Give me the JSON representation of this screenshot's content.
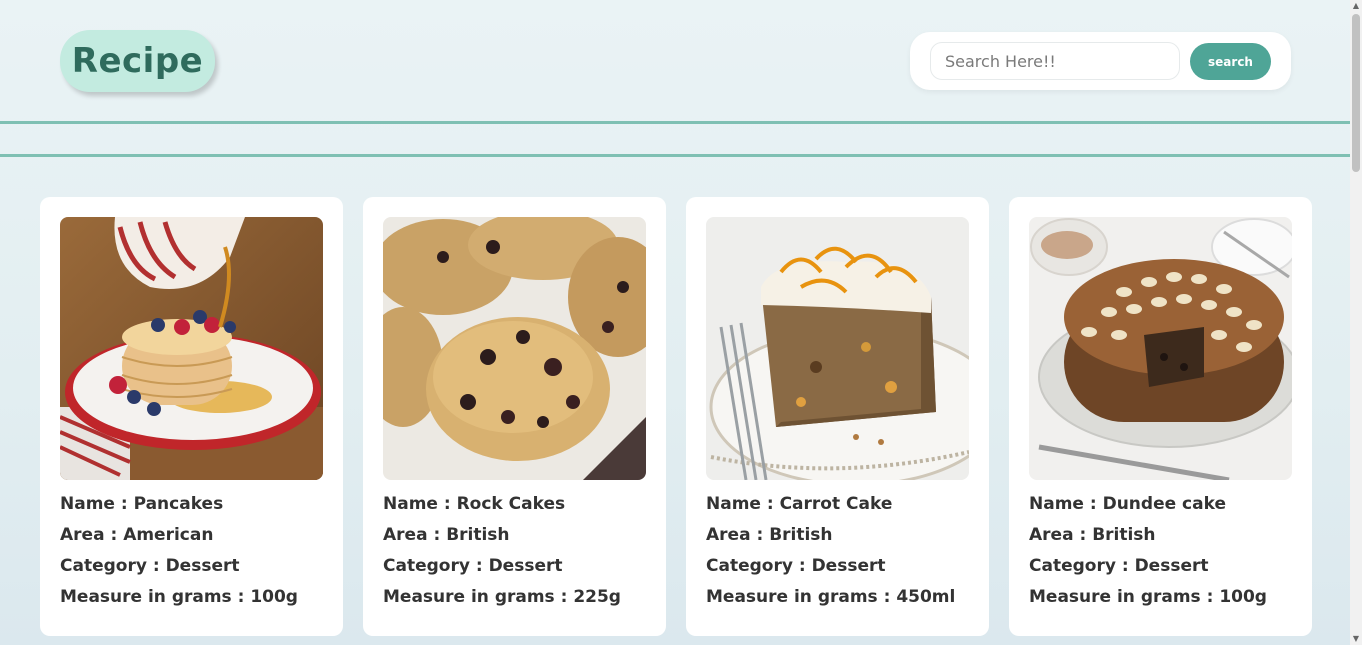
{
  "header": {
    "logo_text": "Recipe",
    "search": {
      "placeholder": "Search Here!!",
      "value": "",
      "button_label": "search"
    }
  },
  "labels": {
    "name": "Name : ",
    "area": "Area : ",
    "category": "Category : ",
    "measure": "Measure in grams : "
  },
  "recipes": [
    {
      "name": "Pancakes",
      "area": "American",
      "category": "Dessert",
      "measure": "100g",
      "image": "pancakes-photo"
    },
    {
      "name": "Rock Cakes",
      "area": "British",
      "category": "Dessert",
      "measure": "225g",
      "image": "rock-cakes-photo"
    },
    {
      "name": "Carrot Cake",
      "area": "British",
      "category": "Dessert",
      "measure": "450ml",
      "image": "carrot-cake-photo"
    },
    {
      "name": "Dundee cake",
      "area": "British",
      "category": "Dessert",
      "measure": "100g",
      "image": "dundee-cake-photo"
    }
  ],
  "colors": {
    "accent": "#4fa597",
    "logo_bg": "#c3ebe0",
    "logo_text": "#2f6b5d",
    "rule": "#7fc0b3"
  }
}
